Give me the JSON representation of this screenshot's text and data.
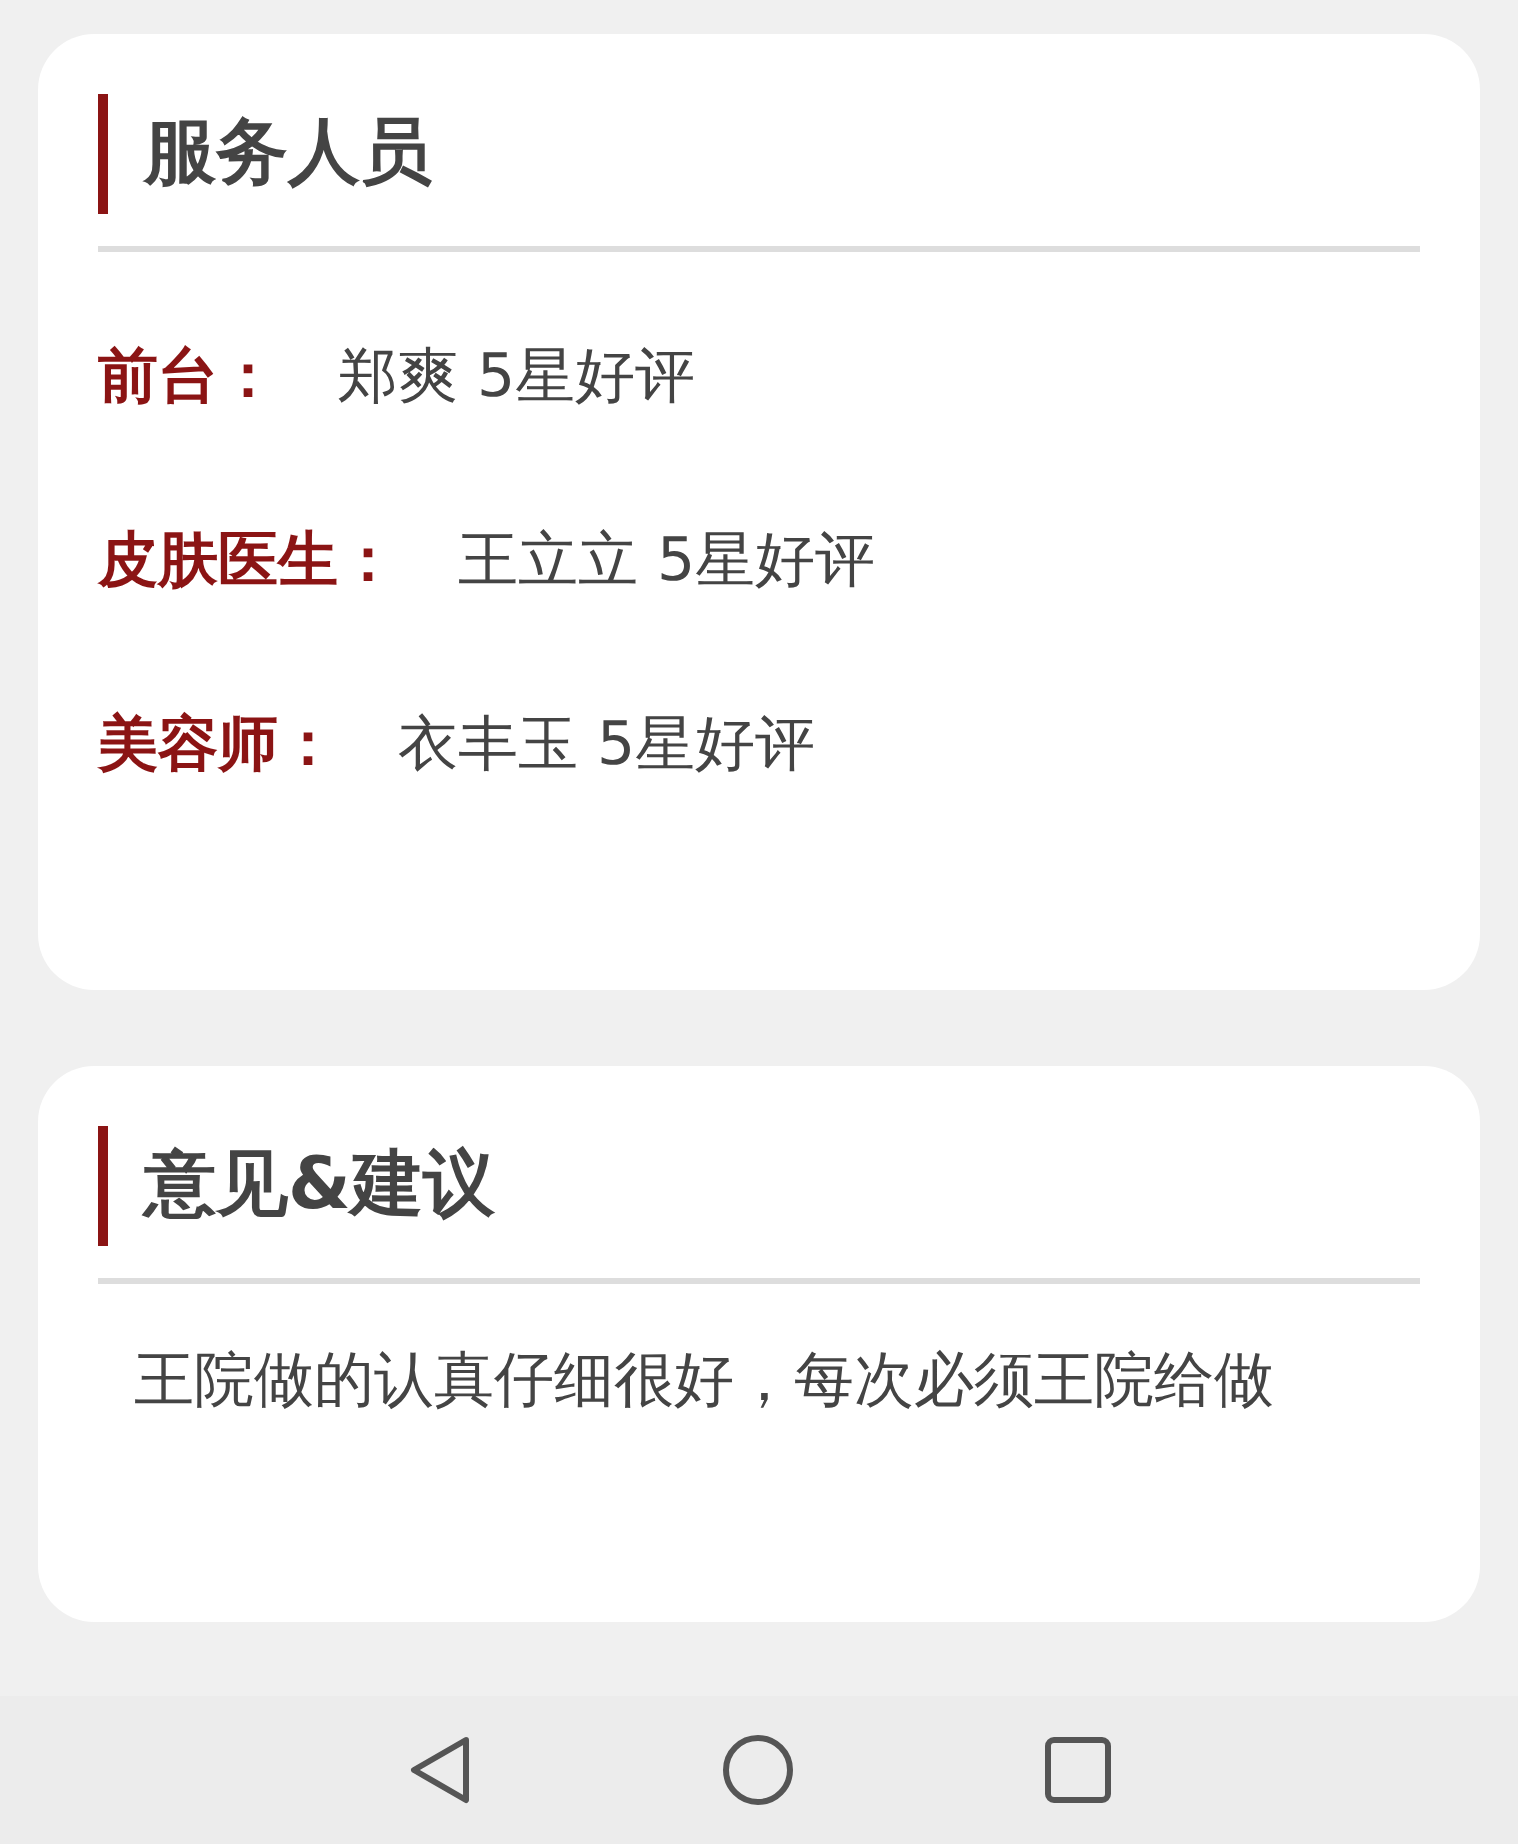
{
  "sections": [
    {
      "kind": "staff",
      "title": "服务人员",
      "rows": [
        {
          "label": "前台：",
          "value": "郑爽 5星好评"
        },
        {
          "label": "皮肤医生：",
          "value": "王立立 5星好评"
        },
        {
          "label": "美容师：",
          "value": "衣丰玉 5星好评"
        }
      ]
    },
    {
      "kind": "text",
      "title": "意见&建议",
      "text": "王院做的认真仔细很好，每次必须王院给做"
    }
  ]
}
